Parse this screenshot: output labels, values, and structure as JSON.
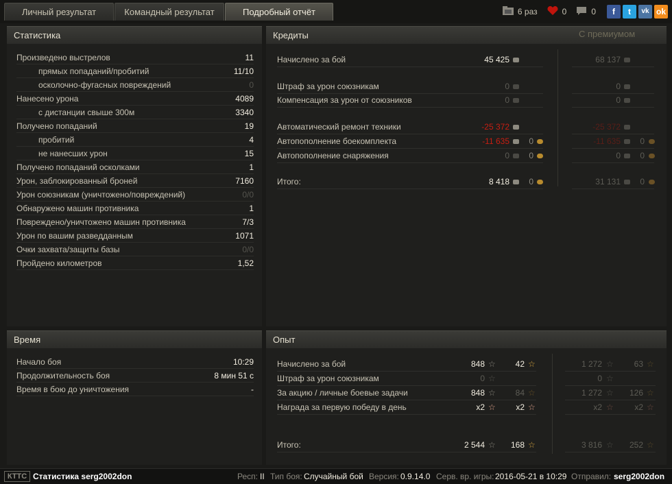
{
  "tabs": [
    {
      "label": "Личный результат"
    },
    {
      "label": "Командный результат"
    },
    {
      "label": "Подробный отчёт"
    }
  ],
  "top_right": {
    "battles": "6 раз",
    "likes": "0",
    "comments": "0",
    "social": [
      "f",
      "t",
      "vk",
      "ok"
    ]
  },
  "stats": {
    "title": "Статистика",
    "rows": [
      {
        "label": "Произведено выстрелов",
        "value": "11"
      },
      {
        "label": "прямых попаданий/пробитий",
        "value": "11/10"
      },
      {
        "label": "осколочно-фугасных повреждений",
        "value": "0"
      },
      {
        "label": "Нанесено урона",
        "value": "4089"
      },
      {
        "label": "с дистанции свыше 300м",
        "value": "3340"
      },
      {
        "label": "Получено попаданий",
        "value": "19"
      },
      {
        "label": "пробитий",
        "value": "4"
      },
      {
        "label": "не нанесших урон",
        "value": "15"
      },
      {
        "label": "Получено попаданий осколками",
        "value": "1"
      },
      {
        "label": "Урон, заблокированный броней",
        "value": "7160"
      },
      {
        "label": "Урон союзникам (уничтожено/повреждений)",
        "value": "0/0"
      },
      {
        "label": "Обнаружено машин противника",
        "value": "1"
      },
      {
        "label": "Повреждено/уничтожено машин противника",
        "value": "7/3"
      },
      {
        "label": "Урон по вашим разведданным",
        "value": "1071"
      },
      {
        "label": "Очки захвата/защиты базы",
        "value": "0/0"
      },
      {
        "label": "Пройдено километров",
        "value": "1,52"
      }
    ]
  },
  "credits": {
    "title": "Кредиты",
    "premium_title": "С премиумом",
    "rows": [
      {
        "label": "Начислено за бой",
        "v": "45 425",
        "g": "",
        "pv": "68 137",
        "pg": ""
      },
      {
        "label": "Штраф за урон союзникам",
        "v": "0",
        "g": "",
        "pv": "0",
        "pg": ""
      },
      {
        "label": "Компенсация за урон от союзников",
        "v": "0",
        "g": "",
        "pv": "0",
        "pg": ""
      },
      {
        "label": "Автоматический ремонт техники",
        "v": "-25 372",
        "g": "",
        "pv": "-25 372",
        "pg": ""
      },
      {
        "label": "Автопополнение боекомплекта",
        "v": "-11 635",
        "g": "0",
        "pv": "-11 635",
        "pg": "0"
      },
      {
        "label": "Автопополнение снаряжения",
        "v": "0",
        "g": "0",
        "pv": "0",
        "pg": "0"
      },
      {
        "label": "Итого:",
        "v": "8 418",
        "g": "0",
        "pv": "31 131",
        "pg": "0"
      }
    ]
  },
  "time": {
    "title": "Время",
    "rows": [
      {
        "label": "Начало боя",
        "value": "10:29"
      },
      {
        "label": "Продолжительность боя",
        "value": "8 мин 51 с"
      },
      {
        "label": "Время в бою до уничтожения",
        "value": "-"
      }
    ]
  },
  "exp": {
    "title": "Опыт",
    "rows": [
      {
        "label": "Начислено за бой",
        "xp": "848",
        "fxp": "42",
        "pxp": "1 272",
        "pfxp": "63"
      },
      {
        "label": "Штраф за урон союзникам",
        "xp": "0",
        "fxp": "",
        "pxp": "0",
        "pfxp": ""
      },
      {
        "label": "За акцию / личные боевые задачи",
        "xp": "848",
        "fxp": "84",
        "pxp": "1 272",
        "pfxp": "126"
      },
      {
        "label": "Награда за первую победу в день",
        "xp": "x2",
        "fxp": "x2",
        "pxp": "x2",
        "pfxp": "x2"
      },
      {
        "label": "Итого:",
        "xp": "2 544",
        "fxp": "168",
        "pxp": "3 816",
        "pfxp": "252"
      }
    ]
  },
  "footer": {
    "logo": "КТТС",
    "title": "Статистика serg2002don",
    "resp_label": "Респ:",
    "resp": "II",
    "type_label": "Тип боя:",
    "type": "Случайный бой",
    "ver_label": "Версия:",
    "ver": "0.9.14.0",
    "time_label": "Серв. вр. игры:",
    "time": "2016-05-21 в 10:29",
    "sender_label": "Отправил:",
    "sender": "serg2002don"
  },
  "colors": {
    "red": "#c81e12",
    "gold": "#b88b2e",
    "bg": "#1a1a18"
  }
}
